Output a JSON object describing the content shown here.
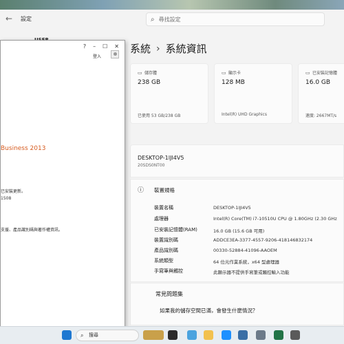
{
  "settings": {
    "title": "設定",
    "search_placeholder": "尋找設定",
    "user": "USER",
    "breadcrumb": [
      "系統",
      "系統資訊"
    ],
    "cards": [
      {
        "label": "儲存體",
        "value": "238 GB",
        "sub": "已使用 53 GB/238 GB"
      },
      {
        "label": "顯示卡",
        "value": "128 MB",
        "sub": "Intel(R) UHD Graphics"
      },
      {
        "label": "已安裝記憶體",
        "value": "16.0 GB",
        "sub": "速度: 2667MT/s"
      }
    ],
    "device": {
      "name": "DESKTOP-1IJI4V5",
      "model": "20SDS0NT00"
    },
    "specs": {
      "heading": "裝置規格",
      "rows": [
        {
          "label": "裝置名稱",
          "value": "DESKTOP-1IJI4V5"
        },
        {
          "label": "處理器",
          "value": "Intel(R) Core(TM) i7-10510U CPU @ 1.80GHz (2.30 GHz"
        },
        {
          "label": "已安裝記憶體(RAM)",
          "value": "16.0 GB (15.6 GB 可用)"
        },
        {
          "label": "裝置識別碼",
          "value": "ADDCE3EA-3377-4557-9206-418146832174"
        },
        {
          "label": "產品識別碼",
          "value": "00330-52884-41096-AAOEM"
        },
        {
          "label": "系統類型",
          "value": "64 位元作業系統，x64 型處理器"
        },
        {
          "label": "手寫筆與觸控",
          "value": "此顯示器不提供手寫筆或觸控輸入功能"
        }
      ]
    },
    "faq": {
      "title": "常見問題集",
      "question": "如果我的儲存空間已滿，會發生什麼情況？"
    }
  },
  "dialog": {
    "controls": [
      "?",
      "–",
      "☐",
      "✕"
    ],
    "login": "登入",
    "product": "Business 2013",
    "lines": [
      "已安裝更新。",
      "1508",
      "支援、產品識別碼與著作權資訊。"
    ]
  },
  "taskbar": {
    "search": "搜尋"
  }
}
